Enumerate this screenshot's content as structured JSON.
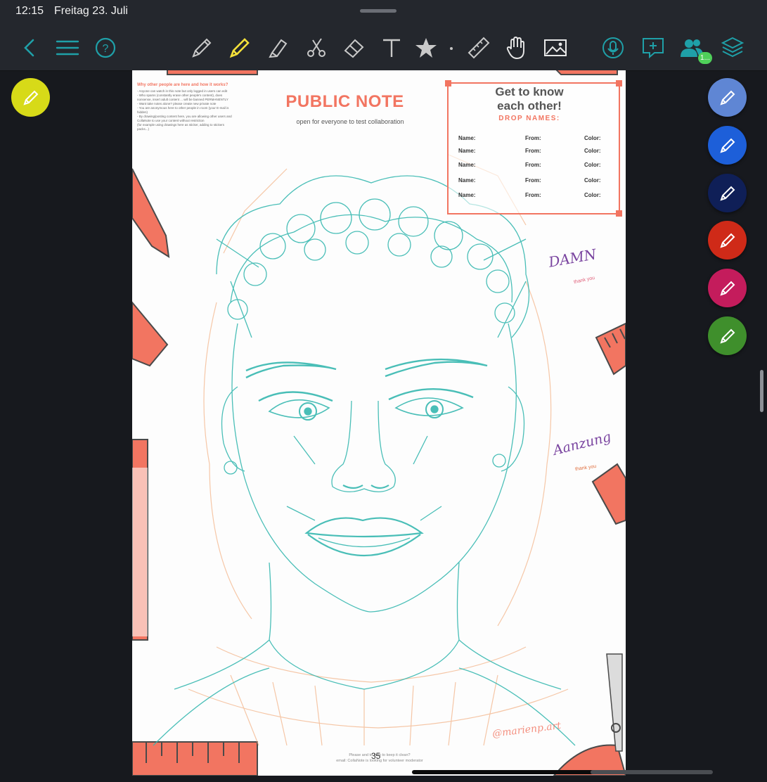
{
  "status": {
    "time": "12:15",
    "date": "Freitag 23. Juli"
  },
  "toolbar": {
    "left": [
      "back-icon",
      "menu-icon",
      "help-icon"
    ],
    "tools": [
      "pen-tool-icon",
      "pencil-tool-icon",
      "highlighter-tool-icon",
      "lasso-scissors-icon",
      "eraser-icon",
      "text-tool-icon",
      "shapes-star-icon",
      "ruler-icon",
      "hand-tool-icon",
      "image-icon"
    ],
    "right": [
      "microphone-icon",
      "add-comment-icon",
      "collaborators-icon",
      "layers-icon"
    ],
    "collaborators_badge": "1...",
    "active_tool": "pencil",
    "accent": "#1fa0a8",
    "active_color": "#f5e13a"
  },
  "left_pen": {
    "color": "#d7da18",
    "icon": "pencil-icon"
  },
  "pen_presets": [
    {
      "color": "#5f86d4"
    },
    {
      "color": "#1d5fd9"
    },
    {
      "color": "#0f1f57"
    },
    {
      "color": "#cf2a18"
    },
    {
      "color": "#c41c5c"
    },
    {
      "color": "#3f8f2c"
    }
  ],
  "page": {
    "info_title": "Why other people are here and how it works?",
    "info_lines": [
      "- Anyone can watch in this note but only logged in users can edit",
      "- Who spams (constantly erase other people's content), does nonsense, insert adult content ... will be banned PERMANENTLY",
      "- Want take notes alone? please create new private note",
      "- You are anonymous here to other people in room (your E-mail is hidden)",
      "- By drawing/posting content here, you are allowing other users and CollaNote to use your content without restriction",
      "(for example using drawings here as sticker, adding to stickers packs...)"
    ],
    "title": "PUBLIC NOTE",
    "subtitle": "open for everyone to test collaboration",
    "names_box": {
      "heading_line1": "Get to know",
      "heading_line2": "each other!",
      "drop_label": "DROP NAMES:",
      "col_name": "Name:",
      "col_from": "From:",
      "col_color": "Color:",
      "rows": 5
    },
    "signature1": "DAMN",
    "signature1_note": "thank you",
    "signature2": "Aanzung",
    "signature2_note": "thank you",
    "watermark": "@marienp.art",
    "page_number": "35",
    "footer_line1": "Please and to help to keep it clean?",
    "footer_line2": "email: CollaNote is looking for volunteer moderator"
  }
}
